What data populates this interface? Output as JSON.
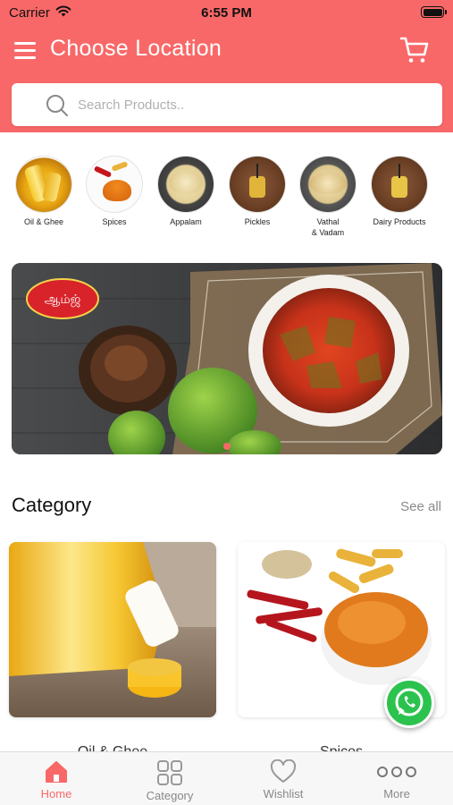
{
  "status_bar": {
    "carrier": "Carrier",
    "time": "6:55 PM"
  },
  "header": {
    "title": "Choose Location"
  },
  "search": {
    "placeholder": "Search Products.."
  },
  "quick_categories": [
    {
      "label": "Oil & Ghee"
    },
    {
      "label": "Spices"
    },
    {
      "label": "Appalam"
    },
    {
      "label": "Pickles"
    },
    {
      "label": "Vathal\n& Vadam"
    },
    {
      "label": "Dairy Products"
    }
  ],
  "banner": {
    "brand": "ஆம்ஜ்"
  },
  "category_section": {
    "title": "Category",
    "see_all": "See all"
  },
  "category_cards": [
    {
      "label": "Oil & Ghee"
    },
    {
      "label": "Spices"
    }
  ],
  "tabbar": {
    "tabs": [
      {
        "label": "Home",
        "icon": "home-icon",
        "active": true
      },
      {
        "label": "Category",
        "icon": "grid-icon",
        "active": false
      },
      {
        "label": "Wishlist",
        "icon": "heart-icon",
        "active": false
      },
      {
        "label": "More",
        "icon": "more-dots-icon",
        "active": false
      }
    ]
  },
  "colors": {
    "accent": "#F96868",
    "whatsapp": "#2CC24E"
  }
}
